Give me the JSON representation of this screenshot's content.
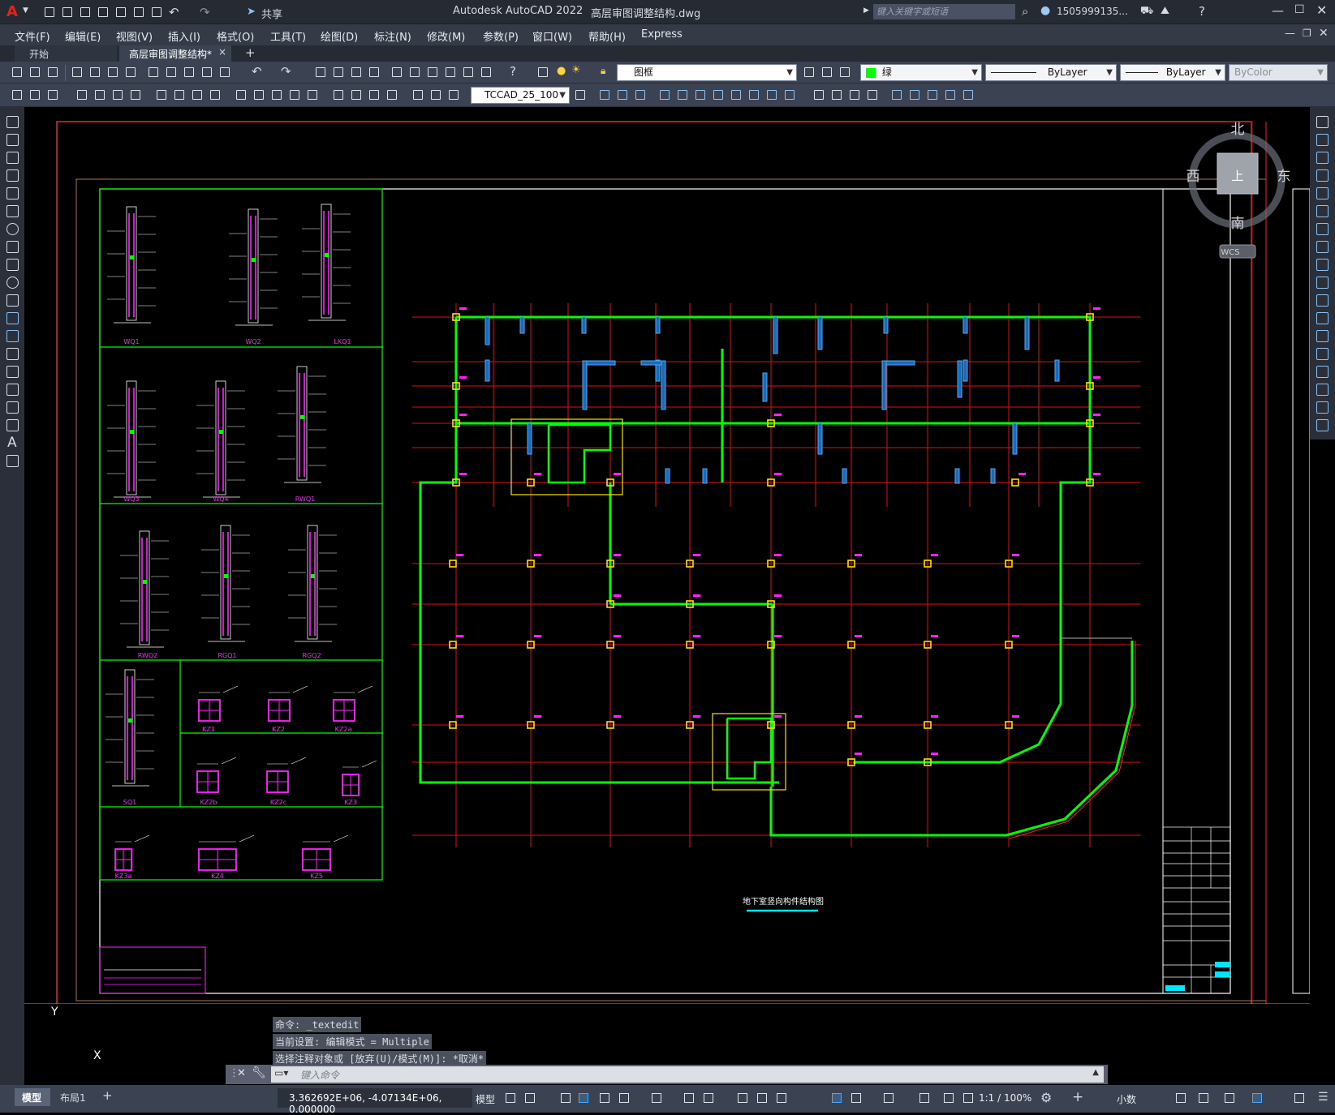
{
  "title_bar": {
    "app_title": "Autodesk AutoCAD 2022",
    "file_title": "高层审图调整结构.dwg",
    "share_label": "共享",
    "search_placeholder": "键入关键字或短语",
    "user_name": "1505999135...",
    "app_logo": "A"
  },
  "menu": {
    "items": [
      "文件(F)",
      "编辑(E)",
      "视图(V)",
      "插入(I)",
      "格式(O)",
      "工具(T)",
      "绘图(D)",
      "标注(N)",
      "修改(M)",
      "参数(P)",
      "窗口(W)",
      "帮助(H)",
      "Express"
    ]
  },
  "doc_tabs": {
    "start_label": "开始",
    "active_label": "高层审图调整结构*",
    "close_glyph": "×",
    "add_glyph": "+"
  },
  "toolbar": {
    "layer_value": "图框",
    "color_value": "绿",
    "linetype_value": "ByLayer",
    "lineweight_value": "ByLayer",
    "plotstyle_value": "ByColor",
    "textstyle_value": "TCCAD_25_100",
    "accent_color": "#00ff00"
  },
  "viewcube": {
    "north": "北",
    "south": "南",
    "east": "东",
    "west": "西",
    "top": "上",
    "wcs": "WCS"
  },
  "drawing": {
    "plan_title": "地下室竖向构件结构图",
    "section_labels": [
      "WQ1",
      "WQ2",
      "LKQ1",
      "WQ3",
      "WQ4",
      "RWQ1",
      "RWQ2",
      "RGQ1",
      "RGQ2",
      "SQ1",
      "KZ1",
      "KZ2",
      "KZ2a",
      "KZ2b",
      "KZ2c",
      "KZ3",
      "KZ3a",
      "KZ4",
      "KZ5"
    ],
    "ucs_y": "Y",
    "ucs_x": "X",
    "colors": {
      "frame_red": "#ff2020",
      "wall_green": "#00ff00",
      "column_yellow": "#ffe000",
      "magenta": "#ff22ff",
      "cyan": "#00e5ff",
      "axis_red": "#e01010"
    }
  },
  "command": {
    "history": [
      "命令: _textedit",
      "当前设置: 编辑模式 = Multiple",
      "选择注释对象或 [放弃(U)/模式(M)]: *取消*"
    ],
    "input_placeholder": "键入命令"
  },
  "layout_tabs": [
    "模型",
    "布局1"
  ],
  "status_bar": {
    "coordinates": "3.362692E+06, -4.07134E+06, 0.000000",
    "model_label": "模型",
    "scale": "1:1 / 100%",
    "units": "小数"
  }
}
